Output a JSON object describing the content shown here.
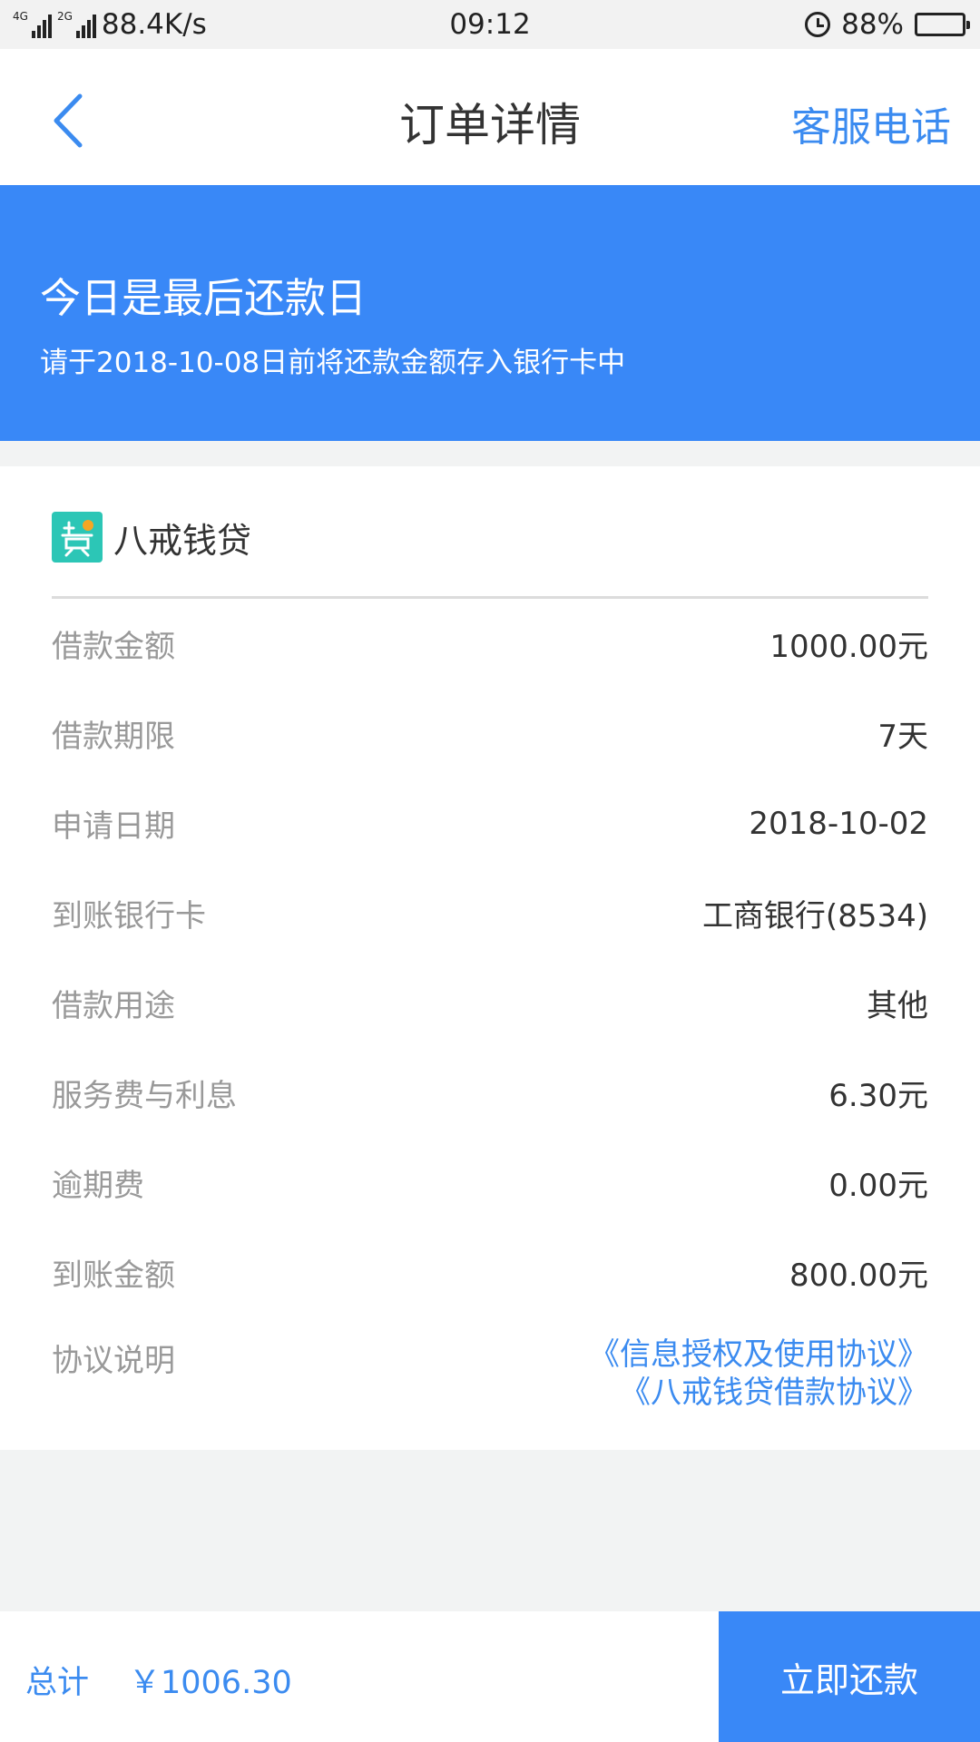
{
  "status_bar": {
    "net_speed": "88.4K/s",
    "time": "09:12",
    "battery": "88%",
    "battery_level": 0.88,
    "signal_tags": [
      "4G",
      "4G",
      "2G"
    ]
  },
  "header": {
    "title": "订单详情",
    "right_action": "客服电话"
  },
  "banner": {
    "title": "今日是最后还款日",
    "subtitle": "请于2018-10-08日前将还款金额存入银行卡中"
  },
  "lender": {
    "name": "八戒钱贷"
  },
  "details": [
    {
      "label": "借款金额",
      "value": "1000.00元"
    },
    {
      "label": "借款期限",
      "value": "7天"
    },
    {
      "label": "申请日期",
      "value": "2018-10-02"
    },
    {
      "label": "到账银行卡",
      "value": "工商银行(8534)"
    },
    {
      "label": "借款用途",
      "value": "其他"
    },
    {
      "label": "服务费与利息",
      "value": "6.30元"
    },
    {
      "label": "逾期费",
      "value": "0.00元"
    },
    {
      "label": "到账金额",
      "value": "800.00元"
    }
  ],
  "agreement": {
    "label": "协议说明",
    "link1": "《信息授权及使用协议》",
    "link2": "《八戒钱贷借款协议》"
  },
  "bottom": {
    "total_label": "总计",
    "total_amount": "￥1006.30",
    "pay_label": "立即还款"
  },
  "colors": {
    "accent": "#3988f7",
    "link": "#3b8bf0",
    "logo": "#2cc6b6"
  },
  "icons": [
    "back-arrow-icon",
    "alarm-icon",
    "battery-icon",
    "signal-icon",
    "lender-logo-icon"
  ]
}
